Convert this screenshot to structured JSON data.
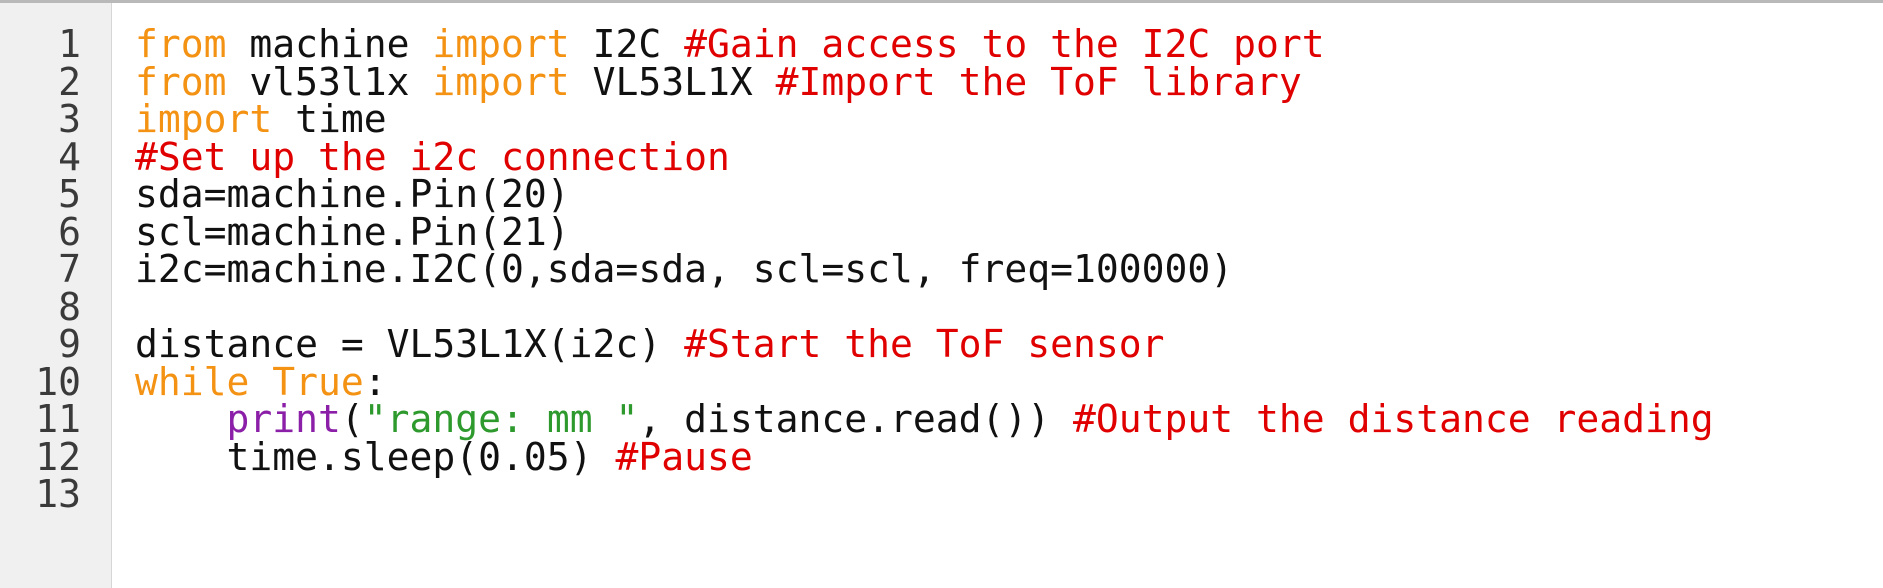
{
  "colors": {
    "keyword": "#f39213",
    "comment": "#e00000",
    "builtin": "#8b1fa8",
    "string": "#2e9a2e",
    "plain": "#111111",
    "gutter_bg": "#f0f0f0",
    "line_number": "#3a3a3a"
  },
  "editor": {
    "line_numbers": [
      "1",
      "2",
      "3",
      "4",
      "5",
      "6",
      "7",
      "8",
      "9",
      "10",
      "11",
      "12",
      "13"
    ],
    "lines": [
      [
        {
          "type": "keyword",
          "text": "from"
        },
        {
          "type": "plain",
          "text": " machine "
        },
        {
          "type": "keyword",
          "text": "import"
        },
        {
          "type": "plain",
          "text": " I2C "
        },
        {
          "type": "comment",
          "text": "#Gain access to the I2C port"
        }
      ],
      [
        {
          "type": "keyword",
          "text": "from"
        },
        {
          "type": "plain",
          "text": " vl53l1x "
        },
        {
          "type": "keyword",
          "text": "import"
        },
        {
          "type": "plain",
          "text": " VL53L1X "
        },
        {
          "type": "comment",
          "text": "#Import the ToF library"
        }
      ],
      [
        {
          "type": "keyword",
          "text": "import"
        },
        {
          "type": "plain",
          "text": " time"
        }
      ],
      [
        {
          "type": "comment",
          "text": "#Set up the i2c connection"
        }
      ],
      [
        {
          "type": "plain",
          "text": "sda=machine.Pin(20)"
        }
      ],
      [
        {
          "type": "plain",
          "text": "scl=machine.Pin(21)"
        }
      ],
      [
        {
          "type": "plain",
          "text": "i2c=machine.I2C(0,sda=sda, scl=scl, freq=100000)"
        }
      ],
      [],
      [
        {
          "type": "plain",
          "text": "distance = VL53L1X(i2c) "
        },
        {
          "type": "comment",
          "text": "#Start the ToF sensor"
        }
      ],
      [
        {
          "type": "keyword",
          "text": "while"
        },
        {
          "type": "plain",
          "text": " "
        },
        {
          "type": "keyword",
          "text": "True"
        },
        {
          "type": "plain",
          "text": ":"
        }
      ],
      [
        {
          "type": "plain",
          "text": "    "
        },
        {
          "type": "builtin",
          "text": "print"
        },
        {
          "type": "plain",
          "text": "("
        },
        {
          "type": "string",
          "text": "\"range: mm \""
        },
        {
          "type": "plain",
          "text": ", distance.read()) "
        },
        {
          "type": "comment",
          "text": "#Output the distance reading"
        }
      ],
      [
        {
          "type": "plain",
          "text": "    time.sleep(0.05) "
        },
        {
          "type": "comment",
          "text": "#Pause"
        }
      ],
      []
    ]
  }
}
